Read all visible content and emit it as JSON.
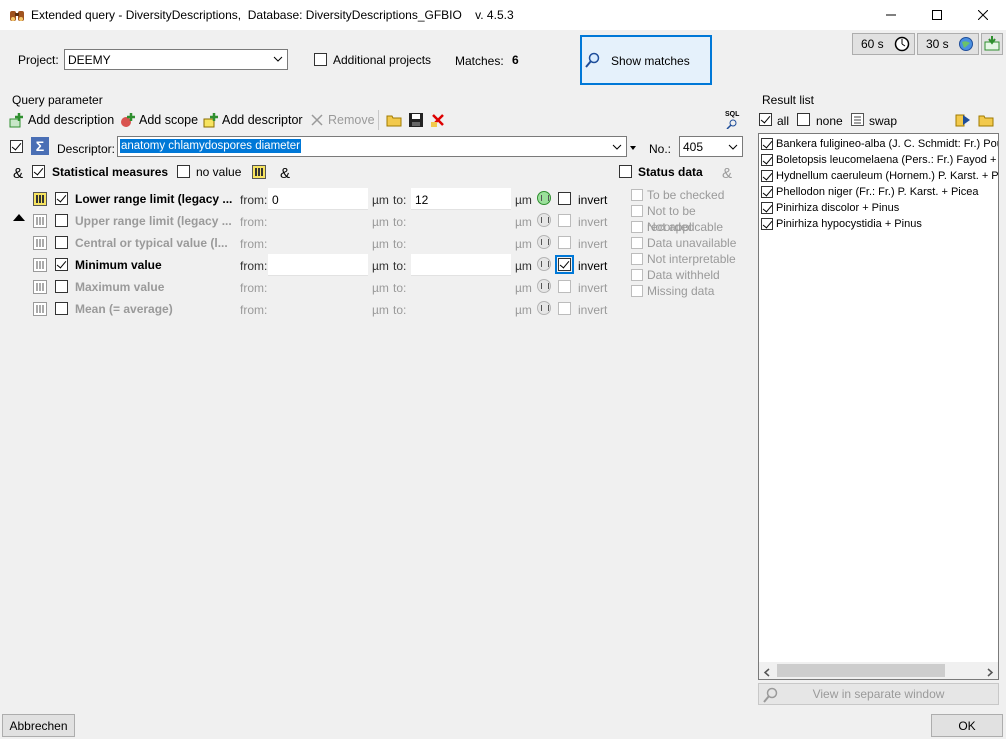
{
  "window": {
    "title": "Extended query - DiversityDescriptions,  Database: DiversityDescriptions_GFBIO    v. 4.5.3"
  },
  "top": {
    "project_label": "Project:",
    "project_value": "DEEMY",
    "additional_projects": "Additional projects",
    "matches_label": "Matches:",
    "matches_value": "6",
    "show_matches": "Show matches",
    "timer1": "60 s",
    "timer2": "30 s"
  },
  "query": {
    "group_title": "Query parameter",
    "add_description": "Add description",
    "add_scope": "Add scope",
    "add_descriptor": "Add descriptor",
    "remove": "Remove",
    "sql": "SQL"
  },
  "descriptor": {
    "label": "Descriptor:",
    "value": "anatomy chlamydospores diameter",
    "no_label": "No.:",
    "no_value": "405"
  },
  "stats": {
    "amp": "&",
    "statistical_measures": "Statistical measures",
    "no_value": "no value",
    "amp2": "&"
  },
  "rows": [
    {
      "label": "Lower range limit (legacy ...",
      "from_label": "from:",
      "from_value": "0",
      "unit1": "µm",
      "to_label": "to:",
      "to_value": "12",
      "unit2": "µm",
      "invert": "invert"
    },
    {
      "label": "Upper range limit (legacy ...",
      "from_label": "from:",
      "from_value": "",
      "unit1": "µm",
      "to_label": "to:",
      "to_value": "",
      "unit2": "µm",
      "invert": "invert"
    },
    {
      "label": "Central or typical value (l...",
      "from_label": "from:",
      "from_value": "",
      "unit1": "µm",
      "to_label": "to:",
      "to_value": "",
      "unit2": "µm",
      "invert": "invert"
    },
    {
      "label": "Minimum value",
      "from_label": "from:",
      "from_value": "",
      "unit1": "µm",
      "to_label": "to:",
      "to_value": "",
      "unit2": "µm",
      "invert": "invert"
    },
    {
      "label": "Maximum value",
      "from_label": "from:",
      "from_value": "",
      "unit1": "µm",
      "to_label": "to:",
      "to_value": "",
      "unit2": "µm",
      "invert": "invert"
    },
    {
      "label": "Mean (= average)",
      "from_label": "from:",
      "from_value": "",
      "unit1": "µm",
      "to_label": "to:",
      "to_value": "",
      "unit2": "µm",
      "invert": "invert"
    }
  ],
  "status": {
    "title": "Status data",
    "amp": "&",
    "items": [
      "To be checked",
      "Not to be recorded",
      "Not applicable",
      "Data unavailable",
      "Not interpretable",
      "Data withheld",
      "Missing data"
    ]
  },
  "results": {
    "title": "Result list",
    "all": "all",
    "none": "none",
    "swap": "swap",
    "view_separate": "View in separate window",
    "items": [
      "Bankera fuligineo-alba (J. C. Schmidt: Fr.) Pouzar",
      "Boletopsis leucomelaena (Pers.: Fr.) Fayod + Picea",
      "Hydnellum caeruleum (Hornem.) P. Karst. + Picea",
      "Phellodon niger (Fr.: Fr.) P. Karst. + Picea",
      "Pinirhiza discolor + Pinus",
      "Pinirhiza hypocystidia + Pinus"
    ]
  },
  "bottom": {
    "cancel": "Abbrechen",
    "ok": "OK"
  }
}
